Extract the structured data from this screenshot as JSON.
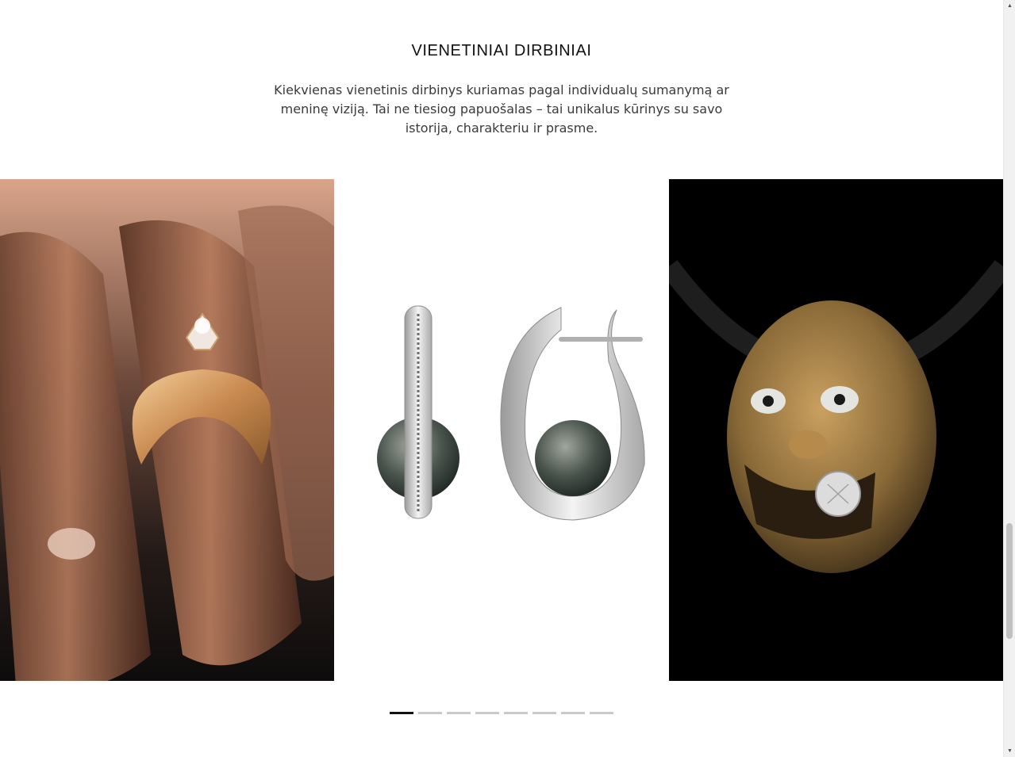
{
  "section": {
    "title": "VIENETINIAI DIRBINIAI",
    "description": "Kiekvienas vienetinis dirbinys kuriamas pagal individualų sumanymą ar meninę viziją. Tai ne tiesiog papuošalas – tai unikalus kūrinys su savo istorija, charakteriu ir prasme."
  },
  "slider": {
    "slides": [
      {
        "image": "ring-on-hand-image"
      },
      {
        "image": "pearl-earrings-image"
      },
      {
        "image": "mask-pendant-image"
      }
    ],
    "dot_count": 8,
    "active_dot": 1
  },
  "colors": {
    "background": "#ffffff",
    "dot_active": "#111111",
    "dot_inactive": "#c9c9c9"
  }
}
